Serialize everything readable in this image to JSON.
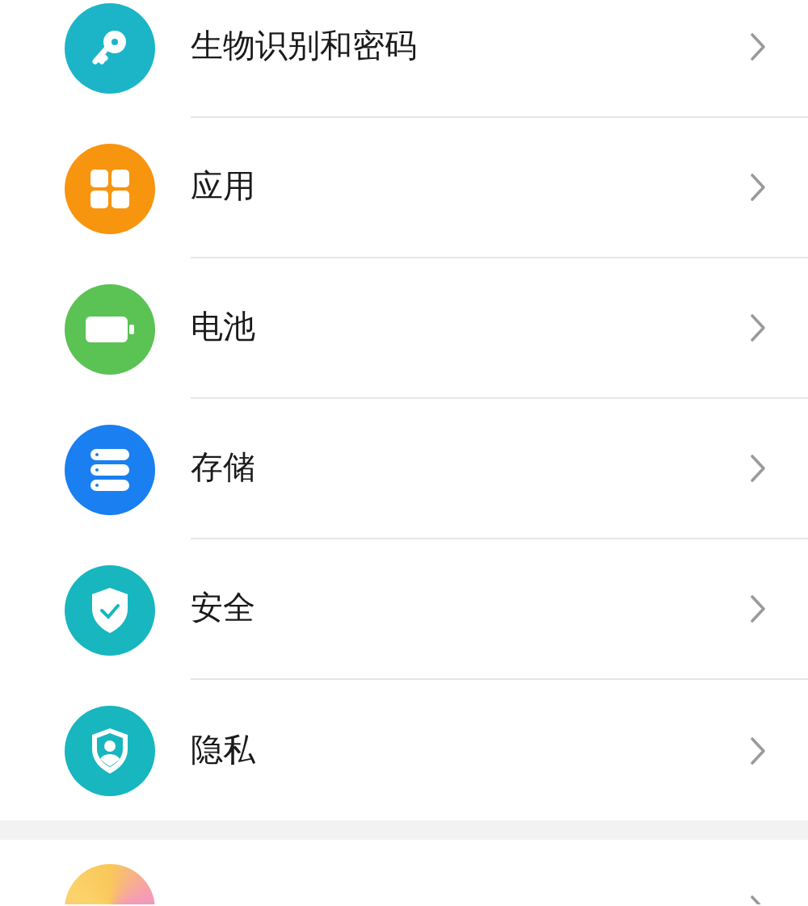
{
  "groups": [
    {
      "items": [
        {
          "label": "生物识别和密码",
          "kind": "key",
          "color": "#1bb5c7"
        },
        {
          "label": "应用",
          "kind": "apps",
          "color": "#f7950f"
        },
        {
          "label": "电池",
          "kind": "battery",
          "color": "#5bc254"
        },
        {
          "label": "存储",
          "kind": "storage",
          "color": "#1a7ff0"
        },
        {
          "label": "安全",
          "kind": "security",
          "color": "#18b6bf"
        },
        {
          "label": "隐私",
          "kind": "privacy",
          "color": "#18b6bf"
        }
      ]
    },
    {
      "items": [
        {
          "kind": "assistant"
        }
      ]
    }
  ]
}
